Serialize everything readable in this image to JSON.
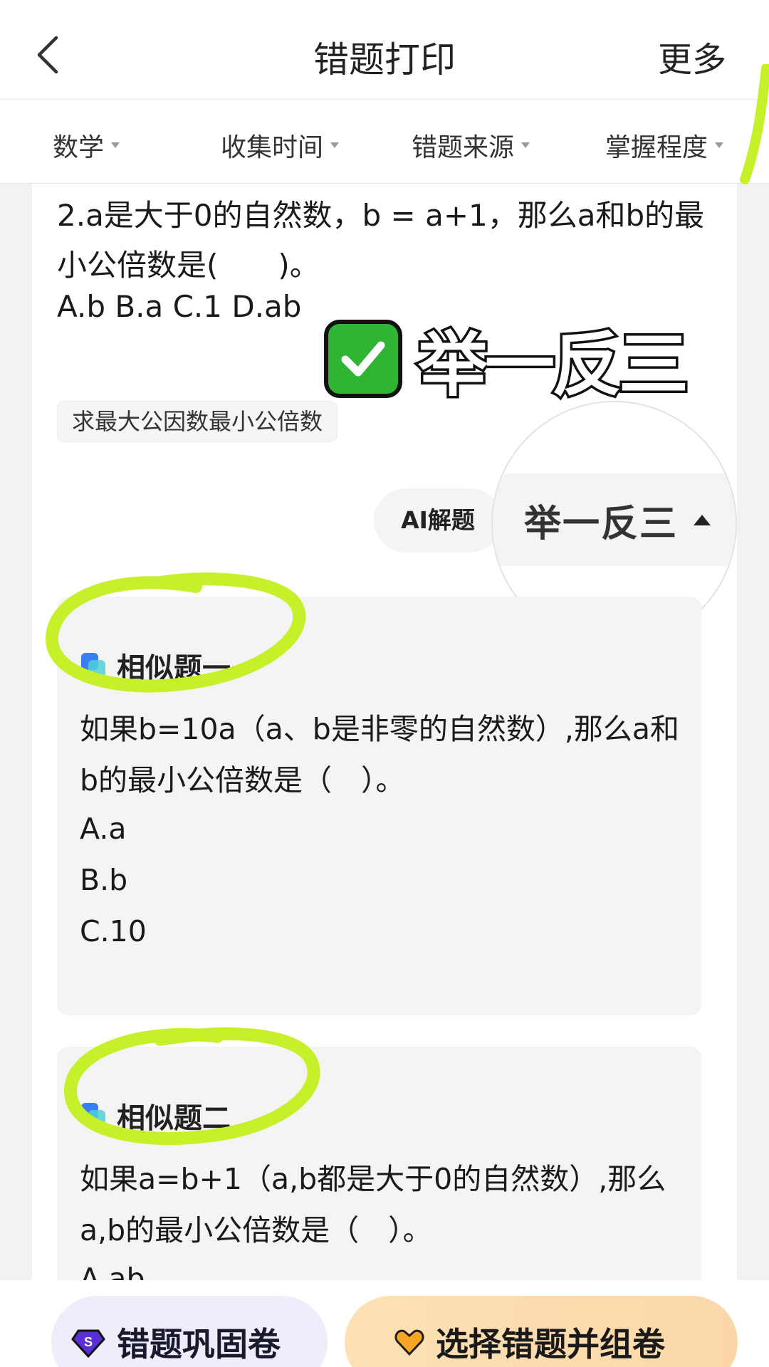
{
  "header": {
    "title": "错题打印",
    "more": "更多"
  },
  "filters": [
    {
      "label": "数学"
    },
    {
      "label": "收集时间"
    },
    {
      "label": "错题来源"
    },
    {
      "label": "掌握程度"
    }
  ],
  "question": {
    "text": "2.a是大于0的自然数，b = a+1，那么a和b的最小公倍数是(　　)。",
    "options": "A.b B.a C.1 D.ab",
    "tag": "求最大公因数最小公倍数"
  },
  "overlay": {
    "title": "举一反三"
  },
  "actions": {
    "ai_solve": "AI解题",
    "infer": "举一反三"
  },
  "similar": [
    {
      "title": "相似题一",
      "body": "如果b=10a（a、b是非零的自然数）,那么a和b的最小公倍数是（　）。",
      "options": [
        "A.a",
        "B.b",
        "C.10"
      ]
    },
    {
      "title": "相似题二",
      "body": "如果a=b+1（a,b都是大于0的自然数）,那么a,b的最小公倍数是（　）。",
      "options": [
        "A.ab"
      ]
    }
  ],
  "bottom": {
    "practice": "错题巩固卷",
    "compose": "选择错题并组卷"
  },
  "colors": {
    "accent_highlight": "#c6f02a",
    "check_green": "#2fb533",
    "compose_bg": "#fde1b4"
  }
}
